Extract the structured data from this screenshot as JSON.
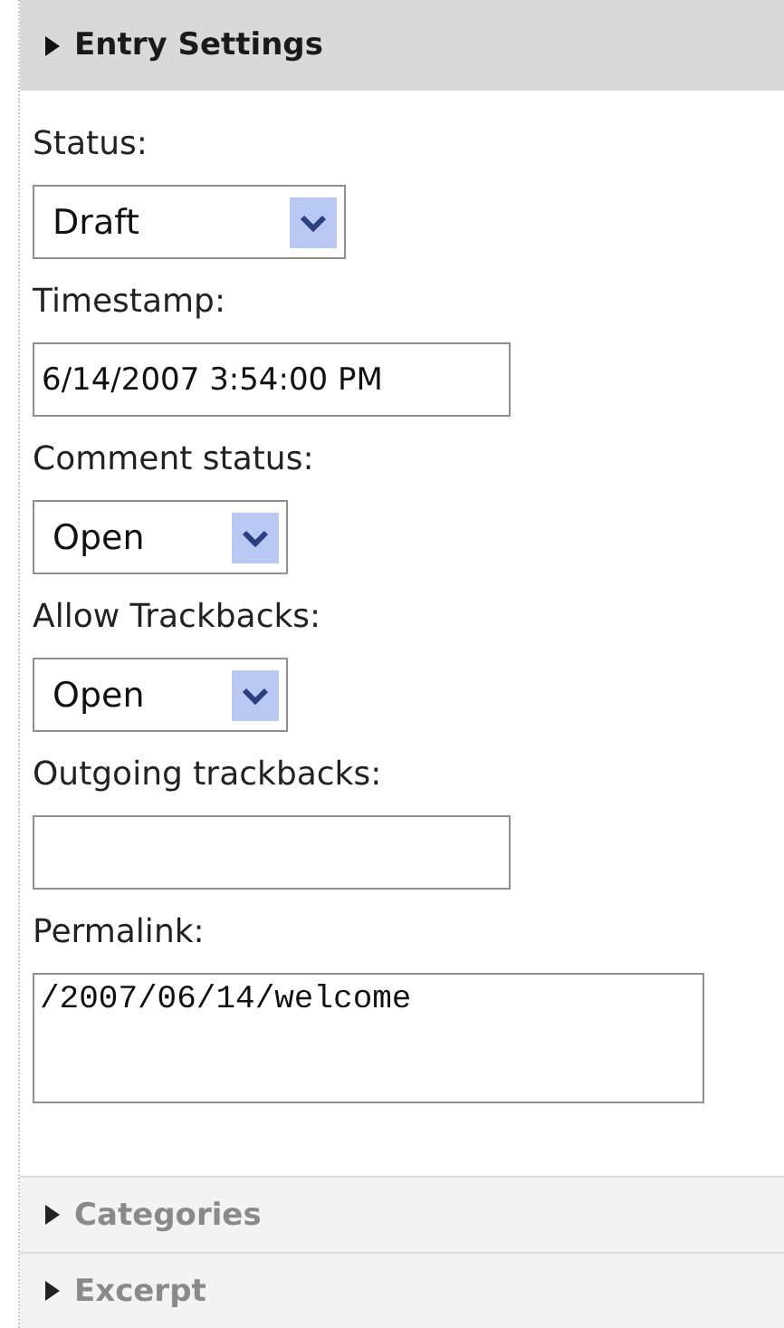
{
  "sections": [
    {
      "title": "Entry Settings",
      "expanded": true,
      "fields": [
        {
          "label": "Status:",
          "kind": "select",
          "value": "Draft"
        },
        {
          "label": "Timestamp:",
          "kind": "text",
          "value": "6/14/2007 3:54:00 PM"
        },
        {
          "label": "Comment status:",
          "kind": "select",
          "value": "Open"
        },
        {
          "label": "Allow Trackbacks:",
          "kind": "select",
          "value": "Open"
        },
        {
          "label": "Outgoing trackbacks:",
          "kind": "text"
        },
        {
          "label": "Permalink:",
          "kind": "textarea",
          "value": "/2007/06/14/welcome"
        }
      ]
    },
    {
      "title": "Categories",
      "expanded": false
    },
    {
      "title": "Excerpt",
      "expanded": false
    }
  ]
}
